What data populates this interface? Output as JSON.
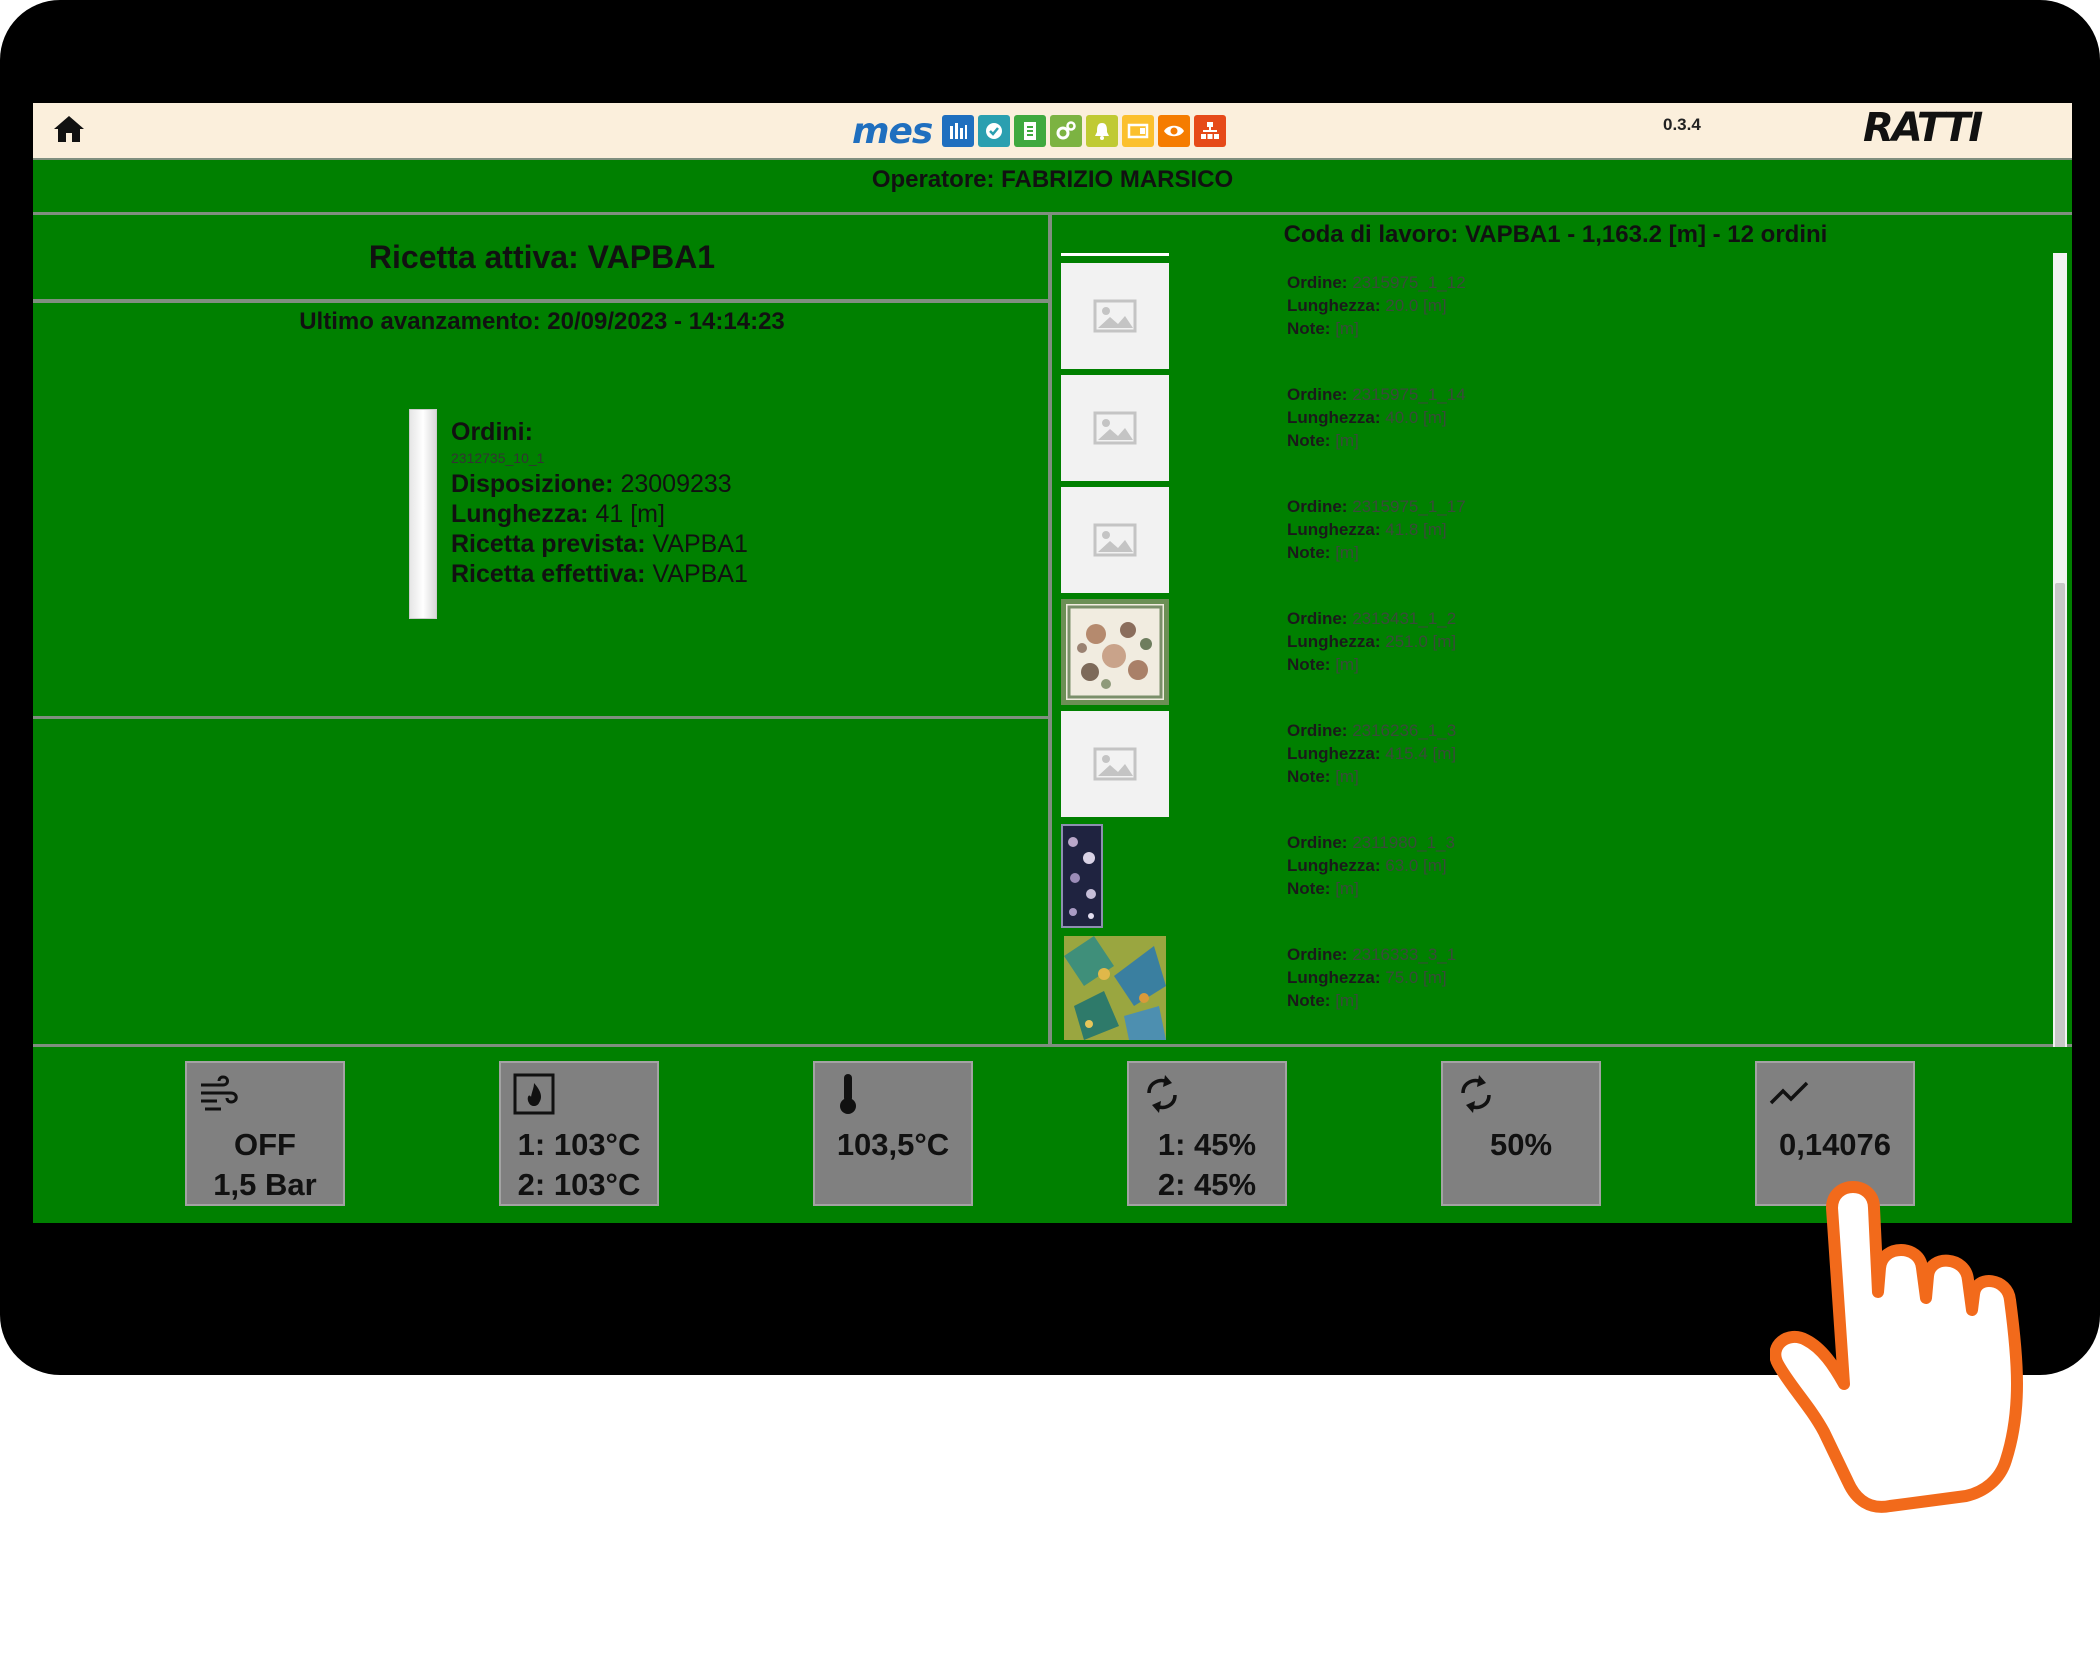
{
  "header": {
    "logo_text": "mes",
    "version": "0.3.4",
    "brand": "RATTI",
    "module_icons": [
      {
        "name": "bars-chart-module-icon",
        "color": "#1f6fbf"
      },
      {
        "name": "check-module-icon",
        "color": "#2a9fb0"
      },
      {
        "name": "document-module-icon",
        "color": "#3fa93f"
      },
      {
        "name": "gears-module-icon",
        "color": "#7cb342"
      },
      {
        "name": "bell-module-icon",
        "color": "#c0ca33"
      },
      {
        "name": "screen-module-icon",
        "color": "#fbc02d"
      },
      {
        "name": "eye-module-icon",
        "color": "#f57c00"
      },
      {
        "name": "hierarchy-module-icon",
        "color": "#e64a19"
      }
    ]
  },
  "operator": "Operatore: FABRIZIO MARSICO",
  "left": {
    "ricetta_attiva": "Ricetta attiva: VAPBA1",
    "ultimo_avanzamento": "Ultimo avanzamento: 20/09/2023 - 14:14:23",
    "ordini_label": "Ordini:",
    "ordini_code": "2312735_10_1",
    "disposizione_label": "Disposizione:",
    "disposizione_value": "23009233",
    "lunghezza_label": "Lunghezza:",
    "lunghezza_value": "41 [m]",
    "ricetta_prevista_label": "Ricetta prevista:",
    "ricetta_prevista_value": "VAPBA1",
    "ricetta_effettiva_label": "Ricetta effettiva:",
    "ricetta_effettiva_value": "VAPBA1"
  },
  "queue": {
    "title": "Coda di lavoro: VAPBA1 - 1,163.2 [m] - 12 ordini",
    "labels": {
      "ordine": "Ordine:",
      "lunghezza": "Lunghezza:",
      "note": "Note:"
    },
    "items": [
      {
        "ordine": "2315975_1_12",
        "lunghezza": "20.0 [m]",
        "note": "[m]",
        "image": "placeholder-image-icon"
      },
      {
        "ordine": "2315975_1_14",
        "lunghezza": "40.0 [m]",
        "note": "[m]",
        "image": "placeholder-image-icon"
      },
      {
        "ordine": "2315975_1_17",
        "lunghezza": "41.8 [m]",
        "note": "[m]",
        "image": "placeholder-image-icon"
      },
      {
        "ordine": "2313431_1_2",
        "lunghezza": "251.0 [m]",
        "note": "[m]",
        "image": "floral-fabric-thumbnail"
      },
      {
        "ordine": "2316236_1_3",
        "lunghezza": "415.4 [m]",
        "note": "[m]",
        "image": "placeholder-image-icon"
      },
      {
        "ordine": "2311980_1_3",
        "lunghezza": "63.0 [m]",
        "note": "[m]",
        "image": "navy-floral-fabric-thumbnail"
      },
      {
        "ordine": "2316333_3_1",
        "lunghezza": "75.0 [m]",
        "note": "[m]",
        "image": "tropical-fabric-thumbnail"
      }
    ]
  },
  "tiles": [
    {
      "icon": "wind-icon",
      "line1": "OFF",
      "line2": "1,5 Bar"
    },
    {
      "icon": "burner-icon",
      "line1": "1: 103°C",
      "line2": "2: 103°C"
    },
    {
      "icon": "thermometer-icon",
      "line1": "103,5°C",
      "line2": ""
    },
    {
      "icon": "refresh-icon",
      "line1": "1: 45%",
      "line2": "2: 45%"
    },
    {
      "icon": "refresh-icon",
      "line1": "50%",
      "line2": ""
    },
    {
      "icon": "trend-line-icon",
      "line1": "0,14076",
      "line2": ""
    }
  ],
  "colors": {
    "background": "#008000",
    "topbar": "#fbefdc",
    "tile": "#808080",
    "hand": "#f26a1b"
  }
}
